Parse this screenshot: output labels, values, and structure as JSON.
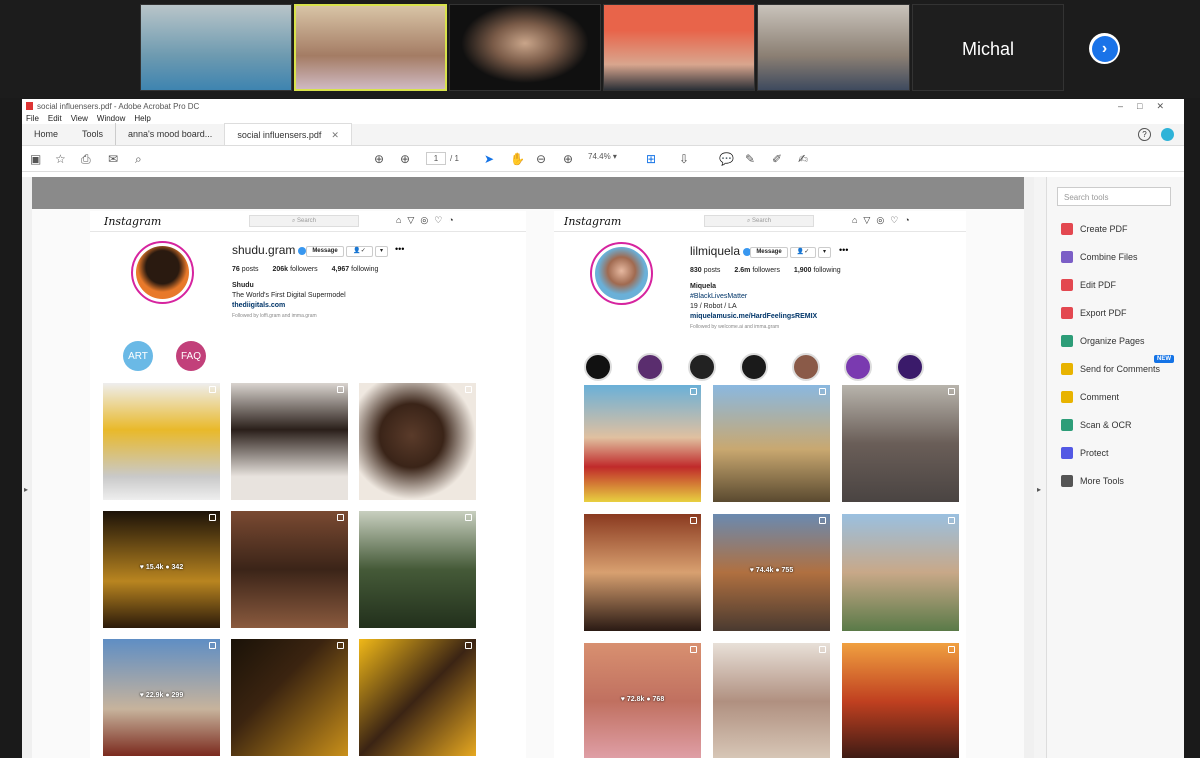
{
  "meeting": {
    "participants": [
      {
        "name": "participant-1",
        "bg": "linear-gradient(180deg,#b9c5c9 0%,#6d9ab0 60%,#3e84b0 100%)"
      },
      {
        "name": "participant-2",
        "bg": "linear-gradient(180deg,#d8c4a6 0%,#a47c64 60%,#cfb9c2 100%)"
      },
      {
        "name": "participant-3",
        "bg": "radial-gradient(ellipse at 50% 45%,#c9a58a 0%,#7a5b48 30%,#101010 60%)"
      },
      {
        "name": "participant-4",
        "bg": "linear-gradient(180deg,#e8644a 0%,#e8644a 30%,#d9a68e 70%,#2b3037 100%)"
      },
      {
        "name": "participant-5",
        "bg": "linear-gradient(180deg,#c9c3bb 0%,#8b7f73 60%,#3e4a5e 100%)"
      }
    ],
    "camera_off_name": "Michal"
  },
  "acrobat": {
    "title": "social influensers.pdf - Adobe Acrobat Pro DC",
    "menu": [
      "File",
      "Edit",
      "View",
      "Window",
      "Help"
    ],
    "tabs": {
      "home": "Home",
      "tools": "Tools",
      "doc1": "anna's mood board...",
      "doc2": "social influensers.pdf"
    },
    "page_current": "1",
    "page_total": "/ 1",
    "zoom": "74.4%",
    "search_tools_placeholder": "Search tools",
    "tools": [
      {
        "label": "Create PDF",
        "color": "#e34850"
      },
      {
        "label": "Combine Files",
        "color": "#7b5ec6"
      },
      {
        "label": "Edit PDF",
        "color": "#e34850"
      },
      {
        "label": "Export PDF",
        "color": "#e34850"
      },
      {
        "label": "Organize Pages",
        "color": "#2d9d78"
      },
      {
        "label": "Send for Comments",
        "color": "#e8b300"
      },
      {
        "label": "Comment",
        "color": "#e8b300"
      },
      {
        "label": "Scan & OCR",
        "color": "#2d9d78"
      },
      {
        "label": "Protect",
        "color": "#5258e4"
      },
      {
        "label": "More Tools",
        "color": "#555555"
      }
    ],
    "new_badge": "NEW"
  },
  "ig_left": {
    "logo": "Instagram",
    "search": "Search",
    "username": "shudu.gram",
    "message_btn": "Message",
    "posts": "76",
    "posts_lbl": "posts",
    "followers": "206k",
    "followers_lbl": "followers",
    "following": "4,967",
    "following_lbl": "following",
    "bio_name": "Shudu",
    "bio_line": "The World's First Digital Supermodel",
    "bio_link": "thediigitals.com",
    "followed_by": "Followed by loffi.gram and imma.gram",
    "highlights": [
      {
        "label": "ART",
        "color": "#6ab9e6"
      },
      {
        "label": "FAQ",
        "color": "#c2407a"
      }
    ],
    "posts_grid": [
      {
        "bg": "linear-gradient(180deg,#eee 0%,#e9b92a 40%,#c9c9c9 80%,#eee 100%)",
        "likes": "",
        "comments": ""
      },
      {
        "bg": "linear-gradient(180deg,#d9d4cf 0%,#2a1f1a 40%,#e8e3de 80%)",
        "likes": "",
        "comments": ""
      },
      {
        "bg": "radial-gradient(ellipse at 45% 45%,#5a3b2a 0%,#3a2418 35%,#efe8e0 70%)",
        "likes": "",
        "comments": ""
      },
      {
        "bg": "linear-gradient(180deg,#1c1208 0%,#b98520 60%,#2b1a0a 100%)",
        "likes": "15.4k",
        "comments": "342"
      },
      {
        "bg": "linear-gradient(180deg,#7a4a32 0%,#3b2418 50%,#8a5a3e 100%)",
        "likes": "",
        "comments": ""
      },
      {
        "bg": "linear-gradient(180deg,#c8cfbf 0%,#455a38 50%,#22301c 100%)",
        "likes": "",
        "comments": ""
      },
      {
        "bg": "linear-gradient(180deg,#5f8ec4 0%,#c7b39c 60%,#7b2a1e 100%)",
        "likes": "22.9k",
        "comments": "299"
      },
      {
        "bg": "linear-gradient(135deg,#1a1208 0%,#3b2410 40%,#c9901a 100%)",
        "likes": "",
        "comments": ""
      },
      {
        "bg": "linear-gradient(135deg,#f0b818 0%,#3b2414 50%,#e6a820 100%)",
        "likes": "",
        "comments": ""
      }
    ]
  },
  "ig_right": {
    "logo": "Instagram",
    "search": "Search",
    "username": "lilmiquela",
    "message_btn": "Message",
    "posts": "830",
    "posts_lbl": "posts",
    "followers": "2.6m",
    "followers_lbl": "followers",
    "following": "1,900",
    "following_lbl": "following",
    "bio_name": "Miquela",
    "bio_hashtag": "#BlackLivesMatter",
    "bio_line": "19 / Robot / LA",
    "bio_link": "miquelamusic.me/HardFeelingsREMIX",
    "followed_by": "Followed by welcome.ai and imma.gram",
    "highlights": [
      "#111111",
      "#5a2d6e",
      "#222222",
      "#1a1a1a",
      "#8a5a48",
      "#7a3ab0",
      "#3a1a6a"
    ],
    "posts_grid": [
      {
        "bg": "linear-gradient(180deg,#6ab0d8 0%,#e0c0a0 45%,#c02a2a 70%,#e8d040 100%)",
        "likes": "",
        "comments": ""
      },
      {
        "bg": "linear-gradient(180deg,#8ab8e0 0%,#c9a870 55%,#5a4a30 100%)",
        "likes": "",
        "comments": ""
      },
      {
        "bg": "linear-gradient(180deg,#b8b4ac 0%,#6a5e58 50%,#4a4442 100%)",
        "likes": "",
        "comments": ""
      },
      {
        "bg": "linear-gradient(180deg,#8a3a20 0%,#d8a070 50%,#2a1a14 100%)",
        "likes": "",
        "comments": ""
      },
      {
        "bg": "linear-gradient(180deg,#6a8ab0 0%,#b07040 50%,#4a3a30 100%)",
        "likes": "74.4k",
        "comments": "755"
      },
      {
        "bg": "linear-gradient(180deg,#9ac0e0 0%,#c8a888 50%,#5a7a48 100%)",
        "likes": "",
        "comments": ""
      },
      {
        "bg": "linear-gradient(180deg,#d89070 0%,#c07060 50%,#e0a0a8 100%)",
        "likes": "72.8k",
        "comments": "768"
      },
      {
        "bg": "linear-gradient(180deg,#e8e0d8 0%,#b09080 50%,#d8c8b8 100%)",
        "likes": "",
        "comments": ""
      },
      {
        "bg": "linear-gradient(180deg,#f0a040 0%,#c04020 50%,#3a1a14 100%)",
        "likes": "",
        "comments": ""
      }
    ]
  }
}
